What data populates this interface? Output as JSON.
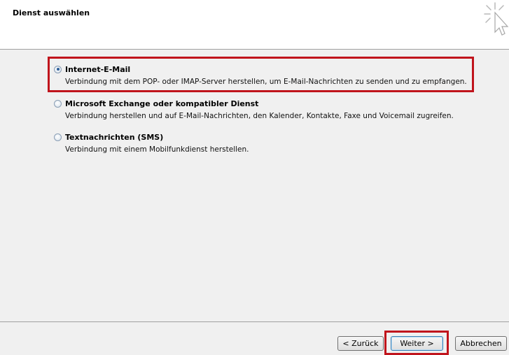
{
  "header": {
    "title": "Dienst auswählen"
  },
  "options": [
    {
      "label": "Internet-E-Mail",
      "description": "Verbindung mit dem POP- oder IMAP-Server herstellen, um E-Mail-Nachrichten zu senden und zu empfangen.",
      "selected": true
    },
    {
      "label": "Microsoft Exchange oder kompatibler Dienst",
      "description": "Verbindung herstellen und auf E-Mail-Nachrichten, den Kalender, Kontakte, Faxe und Voicemail zugreifen.",
      "selected": false
    },
    {
      "label": "Textnachrichten (SMS)",
      "description": "Verbindung mit einem Mobilfunkdienst herstellen.",
      "selected": false
    }
  ],
  "buttons": {
    "back": "< Zurück",
    "next": "Weiter >",
    "cancel": "Abbrechen"
  },
  "colors": {
    "highlight": "#c0141c",
    "content_background": "#f0f0f0"
  },
  "icons": {
    "header_graphic": "click-cursor-icon"
  }
}
